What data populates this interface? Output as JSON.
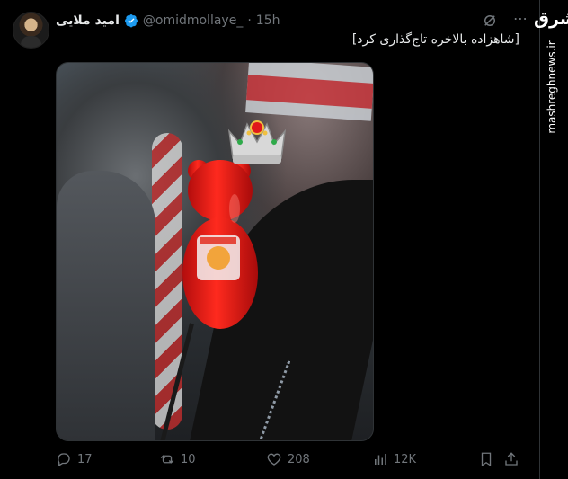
{
  "tweet": {
    "display_name": "امید ملایی",
    "handle": "@omidmollaye_",
    "separator": "·",
    "time": "15h",
    "text": "[شاهزاده بالاخره تاج‌گذاری کرد]",
    "icons": {
      "verified": "verified-badge-icon",
      "grok": "grok-icon",
      "more": "more-icon"
    }
  },
  "actions": {
    "reply_count": "17",
    "retweet_count": "10",
    "like_count": "208",
    "views_count": "12K"
  },
  "watermark": {
    "logo": "مشرق",
    "url": "mashreghnews.ir"
  },
  "colors": {
    "background": "#000000",
    "text": "#e7e9ea",
    "muted": "#71767b",
    "verified": "#1d9bf0",
    "border": "#2f3336"
  }
}
